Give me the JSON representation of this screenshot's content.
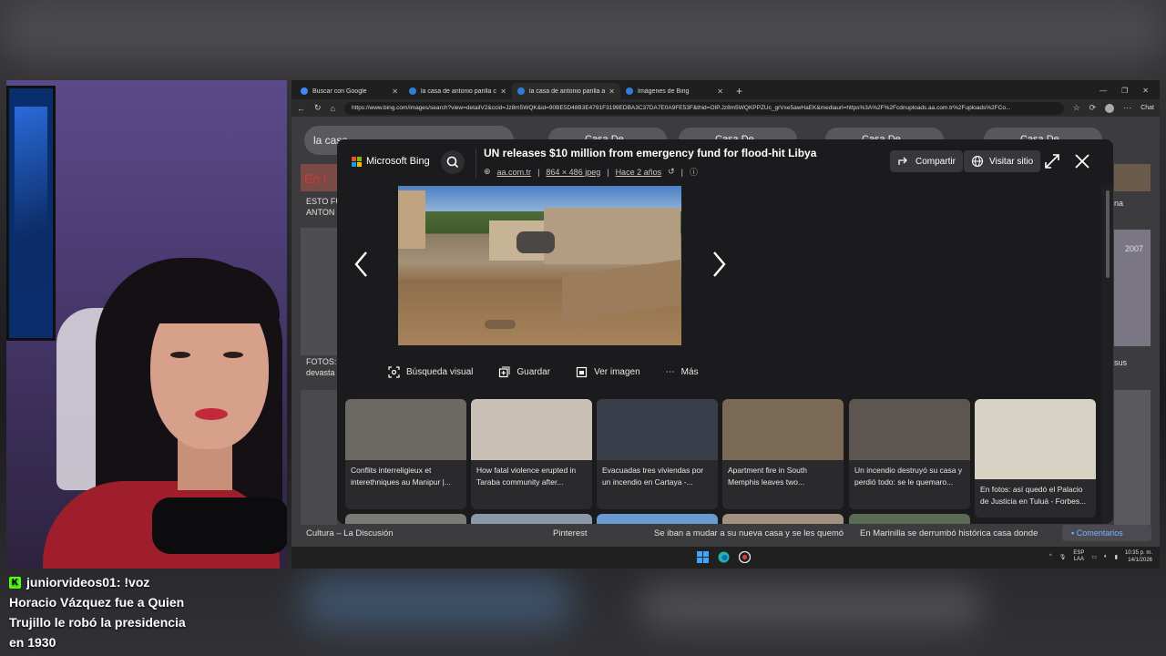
{
  "chat": {
    "username": "juniorvideos01",
    "message_first": " : !voz",
    "message_lines": [
      "Horacio Vázquez fue a Quien",
      "Trujillo le robó la presidencia",
      "en 1930"
    ]
  },
  "browser": {
    "tabs": [
      {
        "label": "Buscar con Google",
        "favicon_color": "#4285f4"
      },
      {
        "label": "la casa de antonio parilla castillo",
        "favicon_color": "#2e7dd8"
      },
      {
        "label": "la casa de antonio parilla antes de",
        "favicon_color": "#2e7dd8"
      },
      {
        "label": "Imágenes de Bing",
        "favicon_color": "#2e7dd8"
      }
    ],
    "active_tab": 2,
    "url": "https://www.bing.com/images/search?view=detailV2&ccid=Jz8m5WQK&id=90BE5D48B3E4791F3199EDBA3C37DA7E0A9FE53F&thid=OIP.Jz8m5WQKPPZUc_grVxe5awHaEK&mediaurl=https%3A%2F%2Fcdnuploads.aa.com.tr%2Fuploads%2FCo...",
    "chat_button": "Chat"
  },
  "background_page": {
    "search_value": "la casa",
    "chips": [
      "Casa De",
      "Casa De",
      "Casa De",
      "Casa De"
    ],
    "left_captions": [
      "En l",
      "ESTO FU",
      "ANTON",
      "FOTOS:",
      "devasta"
    ],
    "right_captions": [
      "na",
      "2007",
      "sus"
    ],
    "footer": [
      "Cultura – La Discusión",
      "Pinterest",
      "Se iban a mudar a su nueva casa y se les quemó por completo – El",
      "En Marinilla se derrumbó histórica casa donde vivió el \"Segundo"
    ],
    "comments_button": "Comentarios"
  },
  "modal": {
    "brand": "Microsoft Bing",
    "title": "UN releases $10 million from emergency fund for flood-hit Libya",
    "source": "aa.com.tr",
    "dimensions": "864 × 486 jpeg",
    "age": "Hace 2 años",
    "share_label": "Compartir",
    "visit_label": "Visitar sitio",
    "actions": [
      "Búsqueda visual",
      "Guardar",
      "Ver imagen",
      "Más"
    ],
    "related": [
      {
        "caption": "Conflits interreligieux et interethniques au Manipur |...",
        "color": "#6d6a66"
      },
      {
        "caption": "How fatal violence erupted in Taraba community after...",
        "color": "#c9c0b5"
      },
      {
        "caption": "Evacuadas tres viviendas por un incendio en Cartaya -...",
        "color": "#3a3e4a"
      },
      {
        "caption": "Apartment fire in South Memphis leaves two...",
        "color": "#7a6a55"
      },
      {
        "caption": "Un incendio destruyó su casa y perdió todo: se le quemaro...",
        "color": "#5c5550"
      },
      {
        "caption": "En fotos: así quedó el Palacio de Justicia en Tuluá - Forbes...",
        "color": "#d8d2c4"
      }
    ],
    "related_row2_colors": [
      "#7c7a76",
      "#8c97a8",
      "#6a9bd0",
      "#a2917e",
      "#5a6a55",
      "#b9bfc8"
    ]
  },
  "taskbar": {
    "lang_top": "ESP",
    "lang_bottom": "LAA",
    "time": "10:35 p. m.",
    "date": "14/1/2026"
  },
  "colors": {
    "kick_green": "#53fc18",
    "modal_bg": "#1b1b1d",
    "link_blue": "#7ab2ff"
  }
}
